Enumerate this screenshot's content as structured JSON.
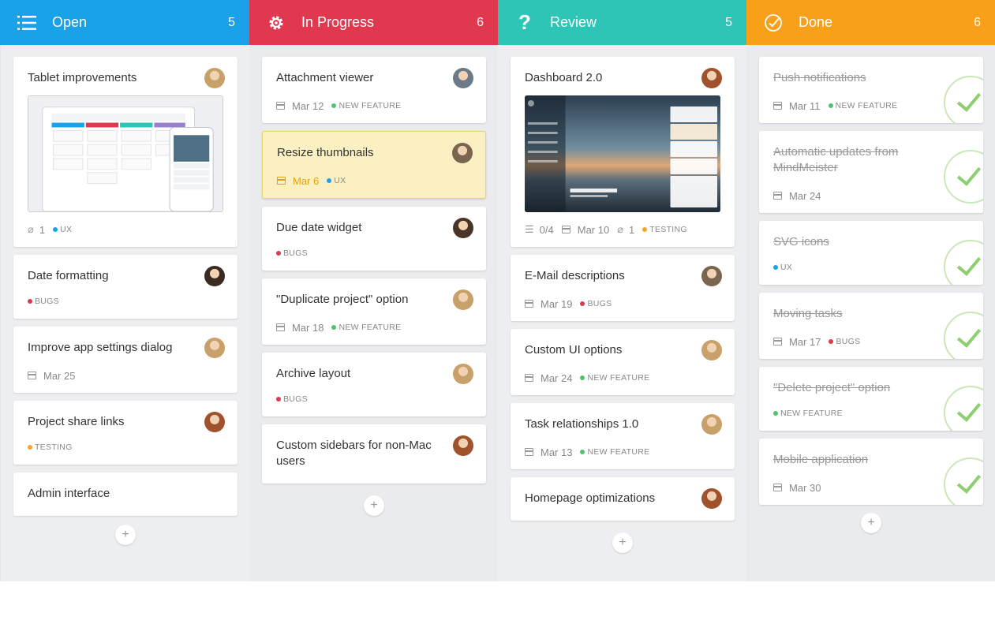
{
  "columns": [
    {
      "title": "Open",
      "count": "5",
      "color": "#1aa2e8",
      "icon": "list-icon",
      "cards": [
        {
          "title": "Tablet improvements",
          "image": "tablet-screenshot",
          "attachments": "1",
          "tag": "UX",
          "tag_color": "#1aa2e8",
          "avatar": "#c8a06a"
        },
        {
          "title": "Date formatting",
          "tag": "BUGS",
          "tag_color": "#e0394f",
          "avatar": "#3b2a22"
        },
        {
          "title": "Improve app settings dialog",
          "date": "Mar 25",
          "avatar": "#c8a06a"
        },
        {
          "title": "Project share links",
          "tag": "TESTING",
          "tag_color": "#f5a623",
          "avatar": "#a0522d"
        },
        {
          "title": "Admin interface"
        }
      ],
      "add_label": "+"
    },
    {
      "title": "In Progress",
      "count": "6",
      "color": "#e0394f",
      "icon": "gear-icon",
      "cards": [
        {
          "title": "Attachment viewer",
          "date": "Mar 12",
          "tag": "NEW FEATURE",
          "tag_color": "#4fc36e",
          "avatar": "#6b7a86"
        },
        {
          "title": "Resize thumbnails",
          "date": "Mar 6",
          "tag": "UX",
          "tag_color": "#1aa2e8",
          "avatar": "#7a6550",
          "highlight": true
        },
        {
          "title": "Due date widget",
          "tag": "BUGS",
          "tag_color": "#e0394f",
          "avatar": "#4a3426"
        },
        {
          "title": "\"Duplicate project\" option",
          "date": "Mar 18",
          "tag": "NEW FEATURE",
          "tag_color": "#4fc36e",
          "avatar": "#c8a06a"
        },
        {
          "title": "Archive layout",
          "tag": "BUGS",
          "tag_color": "#e0394f",
          "avatar": "#c8a06a"
        },
        {
          "title": "Custom sidebars for non-Mac users",
          "avatar": "#a0522d"
        }
      ],
      "add_label": "+"
    },
    {
      "title": "Review",
      "count": "5",
      "color": "#2ec4b6",
      "icon": "question-icon",
      "cards": [
        {
          "title": "Dashboard 2.0",
          "image": "dashboard-screenshot",
          "checklist": "0/4",
          "date": "Mar 10",
          "attachments": "1",
          "tag": "TESTING",
          "tag_color": "#f5a623",
          "avatar": "#a0522d"
        },
        {
          "title": "E-Mail descriptions",
          "date": "Mar 19",
          "tag": "BUGS",
          "tag_color": "#e0394f",
          "avatar": "#7a6550"
        },
        {
          "title": "Custom UI options",
          "date": "Mar 24",
          "tag": "NEW FEATURE",
          "tag_color": "#4fc36e",
          "avatar": "#c8a06a"
        },
        {
          "title": "Task relationships 1.0",
          "date": "Mar 13",
          "tag": "NEW FEATURE",
          "tag_color": "#4fc36e",
          "avatar": "#c8a06a"
        },
        {
          "title": "Homepage optimizations",
          "avatar": "#a0522d"
        }
      ],
      "add_label": "+"
    },
    {
      "title": "Done",
      "count": "6",
      "color": "#f9a01b",
      "icon": "check-circle-icon",
      "cards": [
        {
          "title": "Push notifications",
          "date": "Mar 11",
          "tag": "NEW FEATURE",
          "tag_color": "#4fc36e",
          "done": true
        },
        {
          "title": "Automatic updates from MindMeister",
          "date": "Mar 24",
          "done": true
        },
        {
          "title": "SVG icons",
          "tag": "UX",
          "tag_color": "#1aa2e8",
          "done": true
        },
        {
          "title": "Moving tasks",
          "date": "Mar 17",
          "tag": "BUGS",
          "tag_color": "#e0394f",
          "done": true
        },
        {
          "title": "\"Delete project\" option",
          "tag": "NEW FEATURE",
          "tag_color": "#4fc36e",
          "done": true
        },
        {
          "title": "Mobile application",
          "date": "Mar 30",
          "done": true
        }
      ],
      "add_label": "+"
    }
  ]
}
